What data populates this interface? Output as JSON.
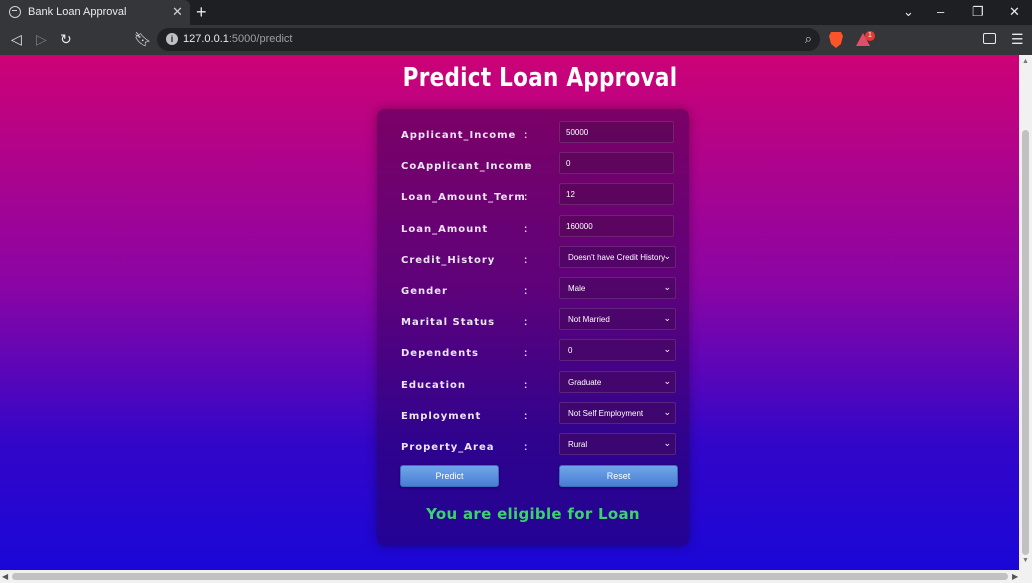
{
  "browser": {
    "tab_title": "Bank Loan Approval",
    "tab_close": "✕",
    "new_tab": "+",
    "url_host": "127.0.0.1",
    "url_path": ":5000/predict",
    "notification_count": "1"
  },
  "page": {
    "title": "Predict Loan Approval",
    "form": {
      "colon": ":",
      "rows": [
        {
          "label": "Applicant_Income",
          "type": "input",
          "value": "50000"
        },
        {
          "label": "CoApplicant_Income",
          "type": "input",
          "value": "0"
        },
        {
          "label": "Loan_Amount_Term",
          "type": "input",
          "value": "12"
        },
        {
          "label": "Loan_Amount",
          "type": "input",
          "value": "160000"
        },
        {
          "label": "Credit_History",
          "type": "select",
          "value": "Doesn't have Credit History"
        },
        {
          "label": "Gender",
          "type": "select",
          "value": "Male"
        },
        {
          "label": "Marital Status",
          "type": "select",
          "value": "Not Married"
        },
        {
          "label": "Dependents",
          "type": "select",
          "value": "0"
        },
        {
          "label": "Education",
          "type": "select",
          "value": "Graduate"
        },
        {
          "label": "Employment",
          "type": "select",
          "value": "Not Self Employment"
        },
        {
          "label": "Property_Area",
          "type": "select",
          "value": "Rural"
        }
      ],
      "predict_label": "Predict",
      "reset_label": "Reset"
    },
    "result": "You are eligible for Loan"
  },
  "colors": {
    "gradient_top": "#cd0276",
    "gradient_bottom": "#1a07d7",
    "result_text": "#39d46a",
    "button": "#5a8fdd"
  }
}
